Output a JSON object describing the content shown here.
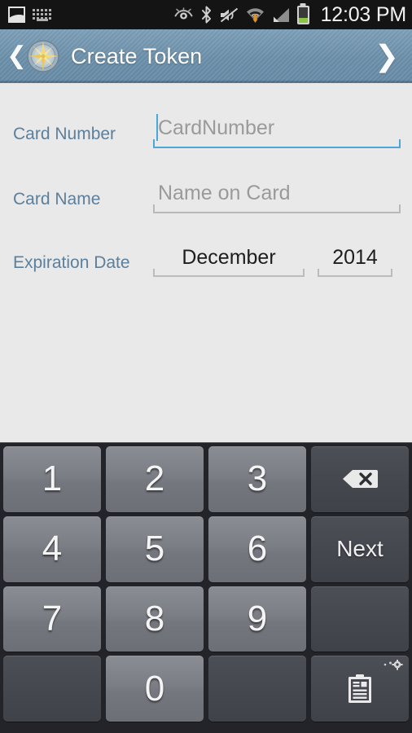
{
  "status_bar": {
    "time": "12:03 PM",
    "left_icons": [
      "screenshot-icon",
      "keyboard-icon"
    ],
    "right_icons": [
      "smart-stay-eye-icon",
      "bluetooth-icon",
      "volume-mute-icon",
      "wifi-icon",
      "cellular-signal-icon",
      "battery-icon"
    ],
    "battery_level_percent": 27
  },
  "action_bar": {
    "title": "Create Token",
    "back_glyph": "❮",
    "forward_glyph": "❯",
    "logo": "compass-rose-logo",
    "background_color": "#6f93ad",
    "title_color": "#ffffff"
  },
  "form": {
    "accent_color": "#4aa8d8",
    "label_color": "#5c7f9b",
    "background_color": "#e9e9e9",
    "fields": [
      {
        "label": "Card Number",
        "placeholder": "CardNumber",
        "value": "",
        "focused": true
      },
      {
        "label": "Card Name",
        "placeholder": "Name on Card",
        "value": "",
        "focused": false
      }
    ],
    "expiration": {
      "label": "Expiration Date",
      "month": "December",
      "year": "2014"
    }
  },
  "keyboard": {
    "type": "numeric",
    "rows": [
      [
        {
          "label": "1",
          "kind": "num",
          "name": "key-1"
        },
        {
          "label": "2",
          "kind": "num",
          "name": "key-2"
        },
        {
          "label": "3",
          "kind": "num",
          "name": "key-3"
        },
        {
          "label": "",
          "kind": "backspace",
          "name": "key-backspace"
        }
      ],
      [
        {
          "label": "4",
          "kind": "num",
          "name": "key-4"
        },
        {
          "label": "5",
          "kind": "num",
          "name": "key-5"
        },
        {
          "label": "6",
          "kind": "num",
          "name": "key-6"
        },
        {
          "label": "Next",
          "kind": "action",
          "name": "key-next"
        }
      ],
      [
        {
          "label": "7",
          "kind": "num",
          "name": "key-7"
        },
        {
          "label": "8",
          "kind": "num",
          "name": "key-8"
        },
        {
          "label": "9",
          "kind": "num",
          "name": "key-9"
        },
        {
          "label": "",
          "kind": "blank",
          "name": "key-blank-right"
        }
      ],
      [
        {
          "label": "",
          "kind": "blank",
          "name": "key-blank-left"
        },
        {
          "label": "0",
          "kind": "num",
          "name": "key-0"
        },
        {
          "label": "",
          "kind": "blank",
          "name": "key-blank-mid"
        },
        {
          "label": "",
          "kind": "clipboard",
          "name": "key-clipboard-settings"
        }
      ]
    ],
    "key_face_color": "#7b7e85",
    "key_dark_color": "#45484f",
    "background_color": "#22242a"
  }
}
